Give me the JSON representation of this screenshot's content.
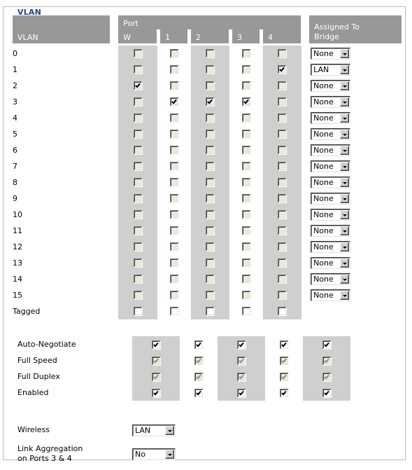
{
  "panel": {
    "legend": "VLAN"
  },
  "table": {
    "vlan_header": "VLAN",
    "port_group_header": "Port",
    "port_columns": [
      "W",
      "1",
      "2",
      "3",
      "4"
    ],
    "assigned_header_line1": "Assigned To",
    "assigned_header_line2": "Bridge",
    "rows": [
      {
        "label": "0",
        "ports": [
          false,
          false,
          false,
          false,
          false
        ],
        "bridge": "None"
      },
      {
        "label": "1",
        "ports": [
          false,
          false,
          false,
          false,
          true
        ],
        "bridge": "LAN"
      },
      {
        "label": "2",
        "ports": [
          true,
          false,
          false,
          false,
          false
        ],
        "bridge": "None"
      },
      {
        "label": "3",
        "ports": [
          false,
          true,
          true,
          true,
          false
        ],
        "bridge": "None"
      },
      {
        "label": "4",
        "ports": [
          false,
          false,
          false,
          false,
          false
        ],
        "bridge": "None"
      },
      {
        "label": "5",
        "ports": [
          false,
          false,
          false,
          false,
          false
        ],
        "bridge": "None"
      },
      {
        "label": "6",
        "ports": [
          false,
          false,
          false,
          false,
          false
        ],
        "bridge": "None"
      },
      {
        "label": "7",
        "ports": [
          false,
          false,
          false,
          false,
          false
        ],
        "bridge": "None"
      },
      {
        "label": "8",
        "ports": [
          false,
          false,
          false,
          false,
          false
        ],
        "bridge": "None"
      },
      {
        "label": "9",
        "ports": [
          false,
          false,
          false,
          false,
          false
        ],
        "bridge": "None"
      },
      {
        "label": "10",
        "ports": [
          false,
          false,
          false,
          false,
          false
        ],
        "bridge": "None"
      },
      {
        "label": "11",
        "ports": [
          false,
          false,
          false,
          false,
          false
        ],
        "bridge": "None"
      },
      {
        "label": "12",
        "ports": [
          false,
          false,
          false,
          false,
          false
        ],
        "bridge": "None"
      },
      {
        "label": "13",
        "ports": [
          false,
          false,
          false,
          false,
          false
        ],
        "bridge": "None"
      },
      {
        "label": "14",
        "ports": [
          false,
          false,
          false,
          false,
          false
        ],
        "bridge": "None"
      },
      {
        "label": "15",
        "ports": [
          false,
          false,
          false,
          false,
          false
        ],
        "bridge": "None"
      }
    ],
    "tagged_row": {
      "label": "Tagged",
      "ports": [
        false,
        false,
        false,
        false,
        false
      ]
    }
  },
  "port_settings": [
    {
      "label": "Auto-Negotiate",
      "ports": [
        true,
        true,
        true,
        true,
        true
      ],
      "disabled": false
    },
    {
      "label": "Full Speed",
      "ports": [
        true,
        true,
        true,
        true,
        true
      ],
      "disabled": true
    },
    {
      "label": "Full Duplex",
      "ports": [
        true,
        true,
        true,
        true,
        true
      ],
      "disabled": true
    },
    {
      "label": "Enabled",
      "ports": [
        true,
        true,
        true,
        true,
        true
      ],
      "disabled": false
    }
  ],
  "controls": {
    "wireless": {
      "label": "Wireless",
      "value": "LAN"
    },
    "link_aggregation": {
      "label_line1": "Link Aggregation",
      "label_line2": "on Ports 3 & 4",
      "value": "No"
    }
  },
  "colors": {
    "legend_text": "#23458b",
    "header_bg": "#989898",
    "band_bg": "#cfcfcf",
    "panel_border": "#b9b9b9"
  }
}
